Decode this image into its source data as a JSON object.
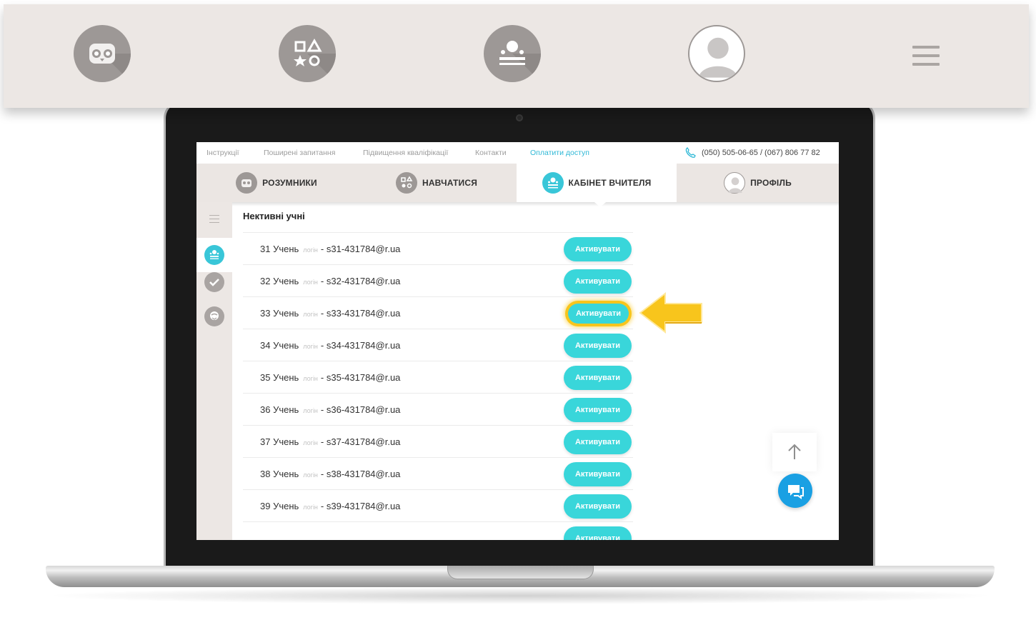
{
  "top_nav": {
    "items": [
      {
        "icon": "owl-icon"
      },
      {
        "icon": "shapes-icon"
      },
      {
        "icon": "teacher-cabinet-icon"
      },
      {
        "icon": "profile-icon"
      },
      {
        "icon": "hamburger-menu-icon"
      }
    ]
  },
  "utility_bar": {
    "links": [
      "Інструкції",
      "Поширені запитання",
      "Підвищення кваліфікації",
      "Контакти"
    ],
    "pay_link": "Оплатити доступ",
    "phone": "(050) 505-06-65 / (067) 806 77 82"
  },
  "main_tabs": [
    {
      "label": "РОЗУМНИКИ",
      "icon": "owl-icon",
      "active": false
    },
    {
      "label": "НАВЧАТИСЯ",
      "icon": "shapes-icon",
      "active": false
    },
    {
      "label": "КАБІНЕТ ВЧИТЕЛЯ",
      "icon": "teacher-cabinet-icon",
      "active": true
    },
    {
      "label": "ПРОФІЛЬ",
      "icon": "profile-icon",
      "active": false
    }
  ],
  "side_rail": {
    "items": [
      {
        "icon": "students-icon",
        "active": true
      },
      {
        "icon": "check-icon",
        "active": false
      },
      {
        "icon": "badge-icon",
        "active": false
      }
    ]
  },
  "list": {
    "title": "Нективні учні",
    "login_label": "логін",
    "button_label": "Активувати",
    "students": [
      {
        "name": "31 Учень",
        "login": "- s31-431784@r.ua"
      },
      {
        "name": "32 Учень",
        "login": "- s32-431784@r.ua"
      },
      {
        "name": "33 Учень",
        "login": "- s33-431784@r.ua",
        "highlighted": true
      },
      {
        "name": "34 Учень",
        "login": "- s34-431784@r.ua"
      },
      {
        "name": "35 Учень",
        "login": "- s35-431784@r.ua"
      },
      {
        "name": "36 Учень",
        "login": "- s36-431784@r.ua"
      },
      {
        "name": "37 Учень",
        "login": "- s37-431784@r.ua"
      },
      {
        "name": "38 Учень",
        "login": "- s38-431784@r.ua"
      },
      {
        "name": "39 Учень",
        "login": "- s39-431784@r.ua"
      },
      {
        "name": "",
        "login": ""
      }
    ]
  },
  "colors": {
    "accent": "#39d6da",
    "highlight": "#f8c51c",
    "chat": "#1aa0e3",
    "nav_bg": "#ece7e4"
  }
}
